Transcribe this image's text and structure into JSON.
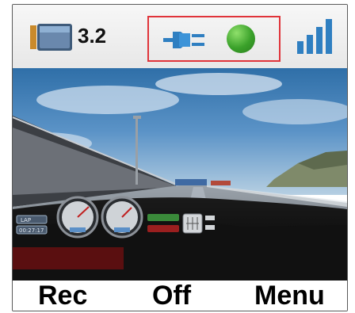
{
  "status_bar": {
    "battery_icon": "battery-icon",
    "version": "3.2",
    "connection_icon": "plug-icon",
    "status_indicator_color": "#3aa12a",
    "signal_icon": "signal-strength-icon",
    "highlight_color": "#e0343a"
  },
  "game_view": {
    "scene": "racing-game",
    "hud": {
      "lap_box": "LAP",
      "time_box": "00:27:17",
      "left_indicator_color": "#3a8a3a",
      "right_indicator_color": "#9a1f1f",
      "damage_bar_color": "#5a0f10"
    }
  },
  "softkeys": {
    "left": "Rec",
    "middle": "Off",
    "right": "Menu"
  }
}
